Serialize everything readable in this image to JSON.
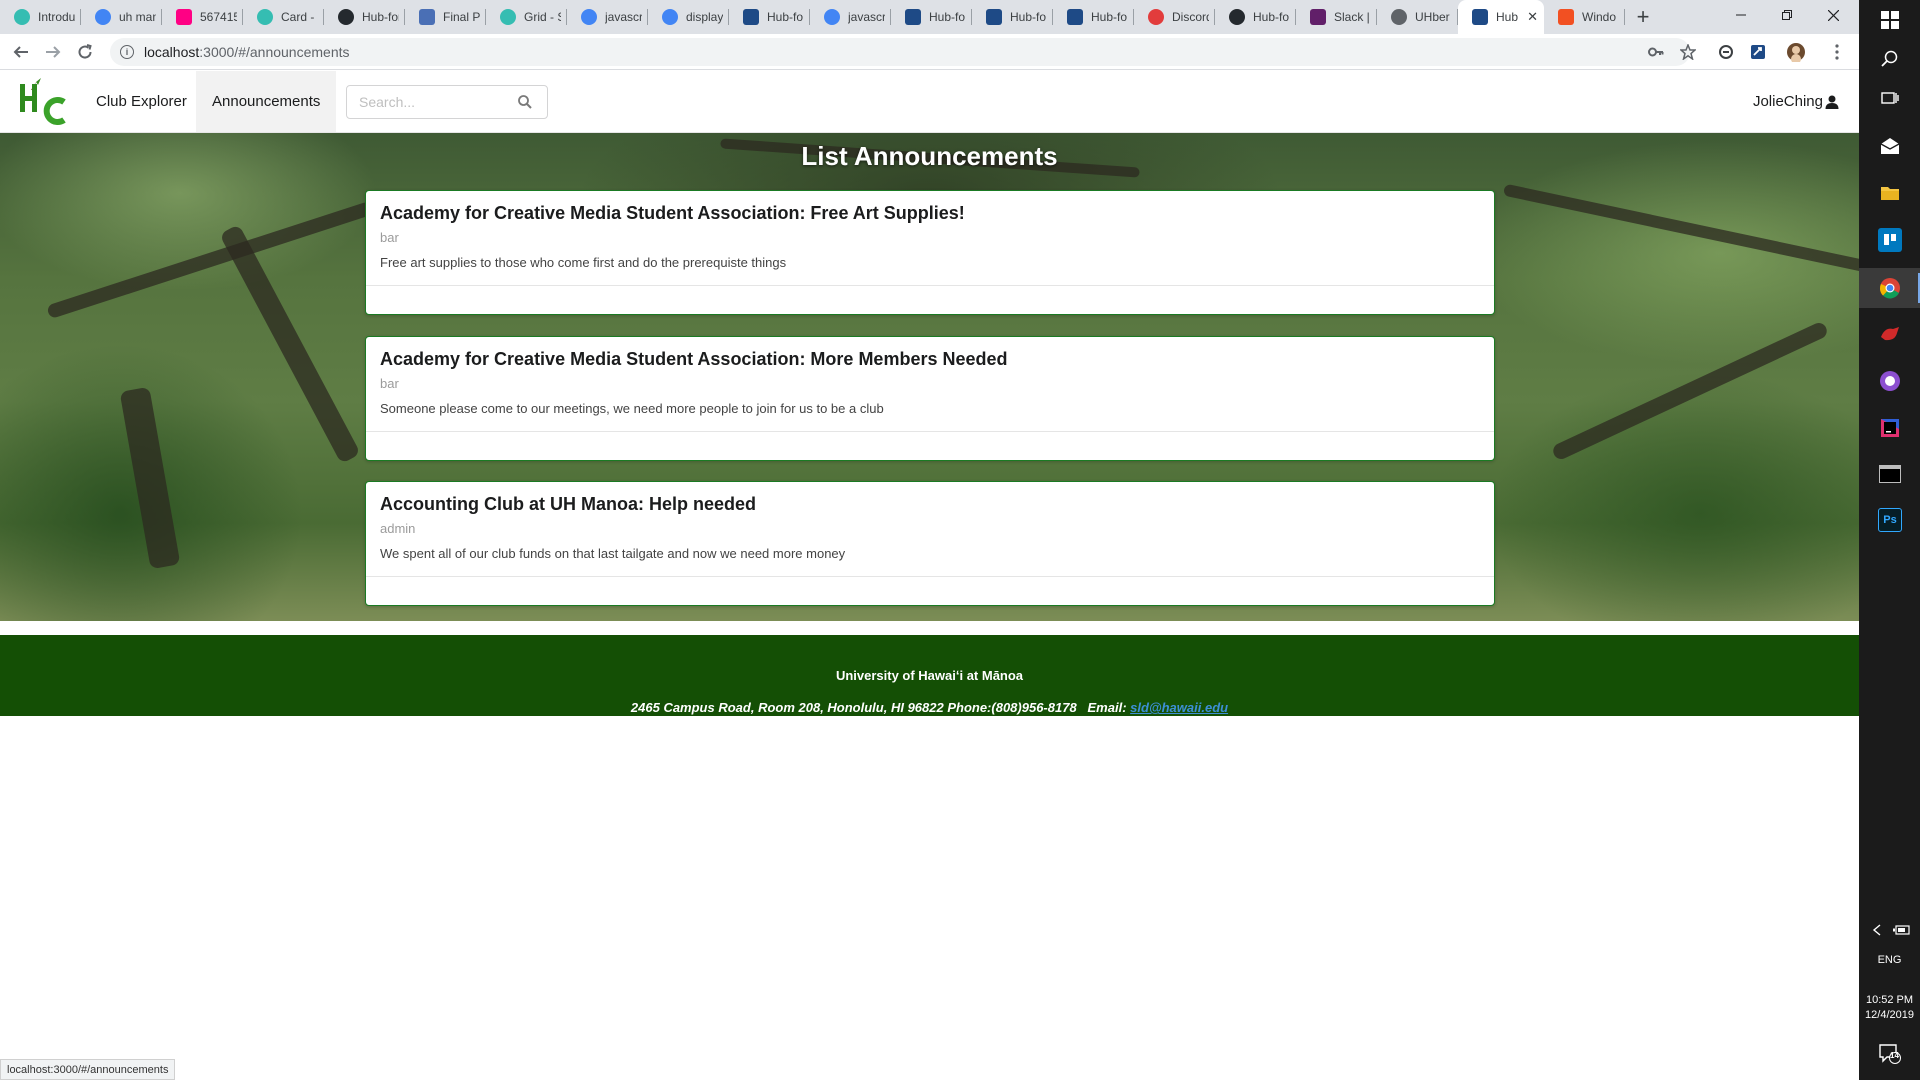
{
  "browser": {
    "tabs": [
      {
        "title": "Introdu",
        "icon": "semantic-ui-icon",
        "color": "#35bdb2"
      },
      {
        "title": "uh man",
        "icon": "google-icon",
        "color": "#4285f4"
      },
      {
        "title": "567415",
        "icon": "flickr-icon",
        "color": "#ff0084"
      },
      {
        "title": "Card - S",
        "icon": "semantic-ui-icon",
        "color": "#35bdb2"
      },
      {
        "title": "Hub-for",
        "icon": "github-icon",
        "color": "#24292e"
      },
      {
        "title": "Final Pr",
        "icon": "document-icon",
        "color": "#4a6fb5"
      },
      {
        "title": "Grid - S",
        "icon": "semantic-ui-icon",
        "color": "#35bdb2"
      },
      {
        "title": "javascri",
        "icon": "google-icon",
        "color": "#4285f4"
      },
      {
        "title": "display",
        "icon": "google-icon",
        "color": "#4285f4"
      },
      {
        "title": "Hub-fo",
        "icon": "meteor-icon",
        "color": "#1e4a86"
      },
      {
        "title": "javascri",
        "icon": "google-icon",
        "color": "#4285f4"
      },
      {
        "title": "Hub-fo",
        "icon": "meteor-icon",
        "color": "#1e4a86"
      },
      {
        "title": "Hub-fo",
        "icon": "meteor-icon",
        "color": "#1e4a86"
      },
      {
        "title": "Hub-fo",
        "icon": "meteor-icon",
        "color": "#1e4a86"
      },
      {
        "title": "Discord",
        "icon": "discord-icon",
        "color": "#e23c3c"
      },
      {
        "title": "Hub-fo",
        "icon": "github-icon",
        "color": "#24292e"
      },
      {
        "title": "Slack |",
        "icon": "slack-icon",
        "color": "#611f69"
      },
      {
        "title": "UHber",
        "icon": "globe-icon",
        "color": "#5f6368"
      },
      {
        "title": "Hub",
        "icon": "meteor-icon",
        "color": "#1e4a86",
        "active": true
      },
      {
        "title": "Windo",
        "icon": "microsoft-icon",
        "color": "#f25022"
      }
    ],
    "new_tab": "+",
    "url_host": "localhost",
    "url_rest": ":3000/#/announcements",
    "status_url": "localhost:3000/#/announcements"
  },
  "navbar": {
    "logo_text": "HC",
    "items": [
      {
        "label": "Club Explorer",
        "active": false
      },
      {
        "label": "Announcements",
        "active": true
      }
    ],
    "search_placeholder": "Search...",
    "user": "JolieChing"
  },
  "hero": {
    "title": "List Announcements"
  },
  "announcements": [
    {
      "title": "Academy for Creative Media Student Association: Free Art Supplies!",
      "owner": "bar",
      "description": "Free art supplies to those who come first and do the prerequiste things"
    },
    {
      "title": "Academy for Creative Media Student Association: More Members Needed",
      "owner": "bar",
      "description": "Someone please come to our meetings, we need more people to join for us to be a club"
    },
    {
      "title": "Accounting Club at UH Manoa: Help needed",
      "owner": "admin",
      "description": "We spent all of our club funds on that last tailgate and now we need more money"
    }
  ],
  "footer": {
    "name": "University of Hawaiʻi at Mānoa",
    "address": "2465 Campus Road, Room 208, Honolulu, HI 96822 Phone:(808)956-8178",
    "email_label": "Email:",
    "email": "sld@hawaii.edu"
  },
  "taskbar": {
    "lang": "ENG",
    "time": "10:52 PM",
    "date": "12/4/2019",
    "notification_count": "14"
  },
  "colors": {
    "footer_bg": "#144f05",
    "card_border": "#1a7a23",
    "link": "#3d8fd6"
  }
}
